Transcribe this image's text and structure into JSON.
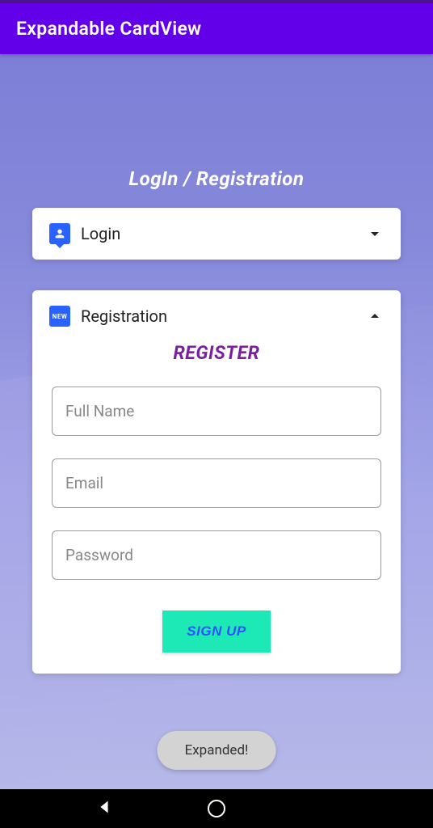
{
  "appBar": {
    "title": "Expandable CardView"
  },
  "section": {
    "title": "LogIn / Registration"
  },
  "loginCard": {
    "title": "Login",
    "iconName": "person-icon"
  },
  "registrationCard": {
    "title": "Registration",
    "iconLabel": "NEW",
    "formTitle": "REGISTER",
    "fields": {
      "fullName": {
        "placeholder": "Full Name"
      },
      "email": {
        "placeholder": "Email"
      },
      "password": {
        "placeholder": "Password"
      }
    },
    "signupLabel": "SIGN UP"
  },
  "toast": {
    "message": "Expanded!"
  }
}
